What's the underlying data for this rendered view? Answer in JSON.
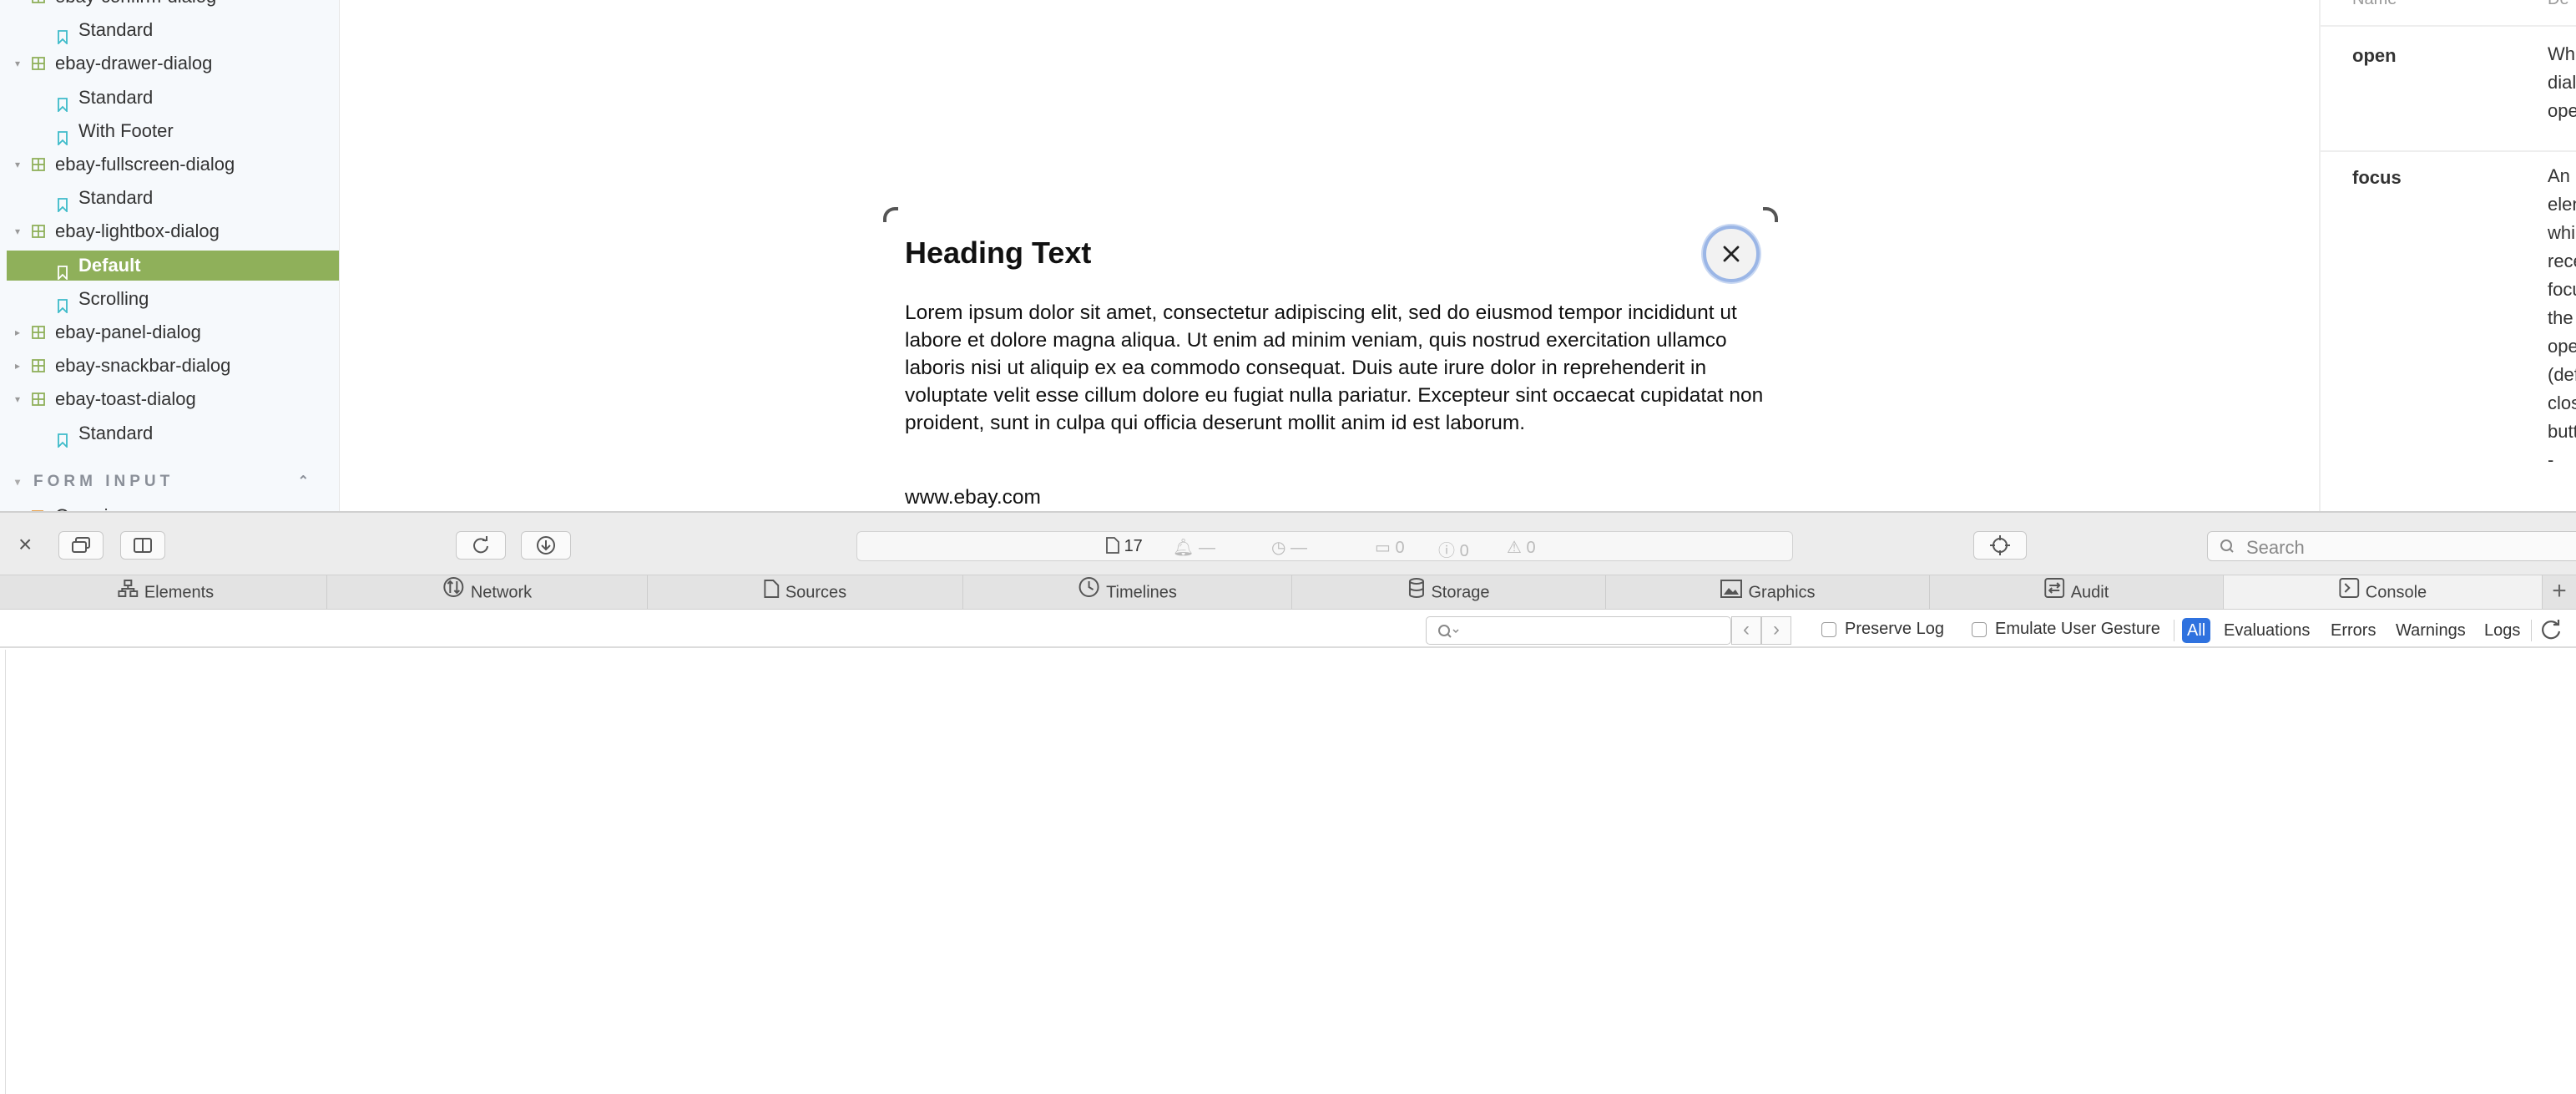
{
  "sidebar": {
    "rows": [
      {
        "kind": "component",
        "label": "ebay-confirm-dialog",
        "expanded": true,
        "selected": false
      },
      {
        "kind": "story",
        "label": "Standard",
        "selected": false
      },
      {
        "kind": "component",
        "label": "ebay-drawer-dialog",
        "expanded": true,
        "selected": false
      },
      {
        "kind": "story",
        "label": "Standard",
        "selected": false
      },
      {
        "kind": "story",
        "label": "With Footer",
        "selected": false
      },
      {
        "kind": "component",
        "label": "ebay-fullscreen-dialog",
        "expanded": true,
        "selected": false
      },
      {
        "kind": "story",
        "label": "Standard",
        "selected": false
      },
      {
        "kind": "component",
        "label": "ebay-lightbox-dialog",
        "expanded": true,
        "selected": false
      },
      {
        "kind": "story",
        "label": "Default",
        "selected": true
      },
      {
        "kind": "story",
        "label": "Scrolling",
        "selected": false
      },
      {
        "kind": "component",
        "label": "ebay-panel-dialog",
        "expanded": false,
        "selected": false
      },
      {
        "kind": "component",
        "label": "ebay-snackbar-dialog",
        "expanded": false,
        "selected": false
      },
      {
        "kind": "component",
        "label": "ebay-toast-dialog",
        "expanded": true,
        "selected": false
      },
      {
        "kind": "story",
        "label": "Standard",
        "selected": false
      }
    ],
    "section_label": "FORM INPUT",
    "overview_label": "Overview",
    "colors": {
      "selected_bg": "#8fb05a",
      "component_icon": "#8fb05a",
      "story_icon": "#3dbbc9"
    }
  },
  "dialog": {
    "heading": "Heading Text",
    "body": "Lorem ipsum dolor sit amet, consectetur adipiscing elit, sed do eiusmod tempor incididunt ut labore et dolore magna aliqua. Ut enim ad minim veniam, quis nostrud exercitation ullamco laboris nisi ut aliquip ex ea commodo consequat. Duis aute irure dolor in reprehenderit in voluptate velit esse cillum dolore eu fugiat nulla pariatur. Excepteur sint occaecat cupidatat non proident, sunt in culpa qui officia deserunt mollit anim id est laborum.",
    "link": "www.ebay.com",
    "close_icon": "close-icon"
  },
  "props_panel": {
    "header_name": "Name",
    "header_desc": "De",
    "rows": [
      {
        "name": "open",
        "desc_lines": [
          "Wh",
          "dial",
          "ope"
        ]
      },
      {
        "name": "focus",
        "desc_lines": [
          "An",
          "elen",
          "whi",
          "rece",
          "focu",
          "the",
          "ope",
          "(def",
          "clos",
          "butt",
          "-"
        ]
      }
    ]
  },
  "devtools": {
    "toolbar": {
      "resource_count": "17",
      "activity": [
        {
          "icon": "bell-icon",
          "text": "—"
        },
        {
          "icon": "clock-icon",
          "text": "—"
        },
        {
          "icon": "message-icon",
          "text": "0"
        },
        {
          "icon": "info-icon",
          "text": "0"
        },
        {
          "icon": "warning-icon",
          "text": "0"
        }
      ],
      "search_placeholder": "Search"
    },
    "tabs": [
      {
        "label": "Elements",
        "icon": "elements-icon",
        "active": false
      },
      {
        "label": "Network",
        "icon": "network-icon",
        "active": false
      },
      {
        "label": "Sources",
        "icon": "sources-icon",
        "active": false
      },
      {
        "label": "Timelines",
        "icon": "timelines-icon",
        "active": false
      },
      {
        "label": "Storage",
        "icon": "storage-icon",
        "active": false
      },
      {
        "label": "Graphics",
        "icon": "graphics-icon",
        "active": false
      },
      {
        "label": "Audit",
        "icon": "audit-icon",
        "active": false
      },
      {
        "label": "Console",
        "icon": "console-icon",
        "active": true
      }
    ],
    "console_bar": {
      "filter_value": "",
      "preserve_log": "Preserve Log",
      "emulate_gesture": "Emulate User Gesture",
      "filters": [
        "All",
        "Evaluations",
        "Errors",
        "Warnings",
        "Logs"
      ],
      "active_filter": "All",
      "accent": "#2f72df"
    }
  }
}
